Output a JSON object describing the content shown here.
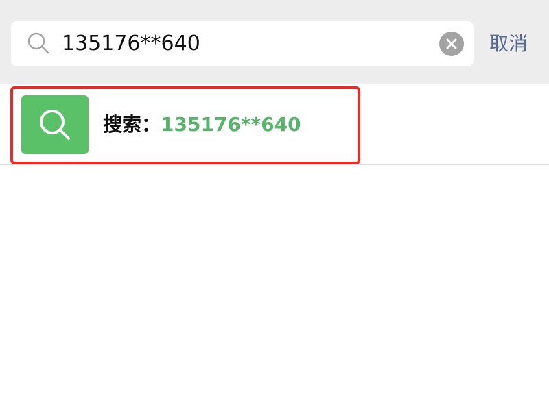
{
  "search": {
    "query": "135176**640",
    "placeholder": "",
    "cancel_label": "取消"
  },
  "result": {
    "prefix": "搜索：",
    "query": "135176**640"
  },
  "icons": {
    "search_field": "search-icon",
    "clear": "clear-circle-icon",
    "result": "search-icon"
  },
  "colors": {
    "accent_green": "#5bc168",
    "query_green": "#57b36a",
    "link_blue": "#566a94",
    "highlight_red": "#ea2a24",
    "header_gray": "#ededed"
  }
}
